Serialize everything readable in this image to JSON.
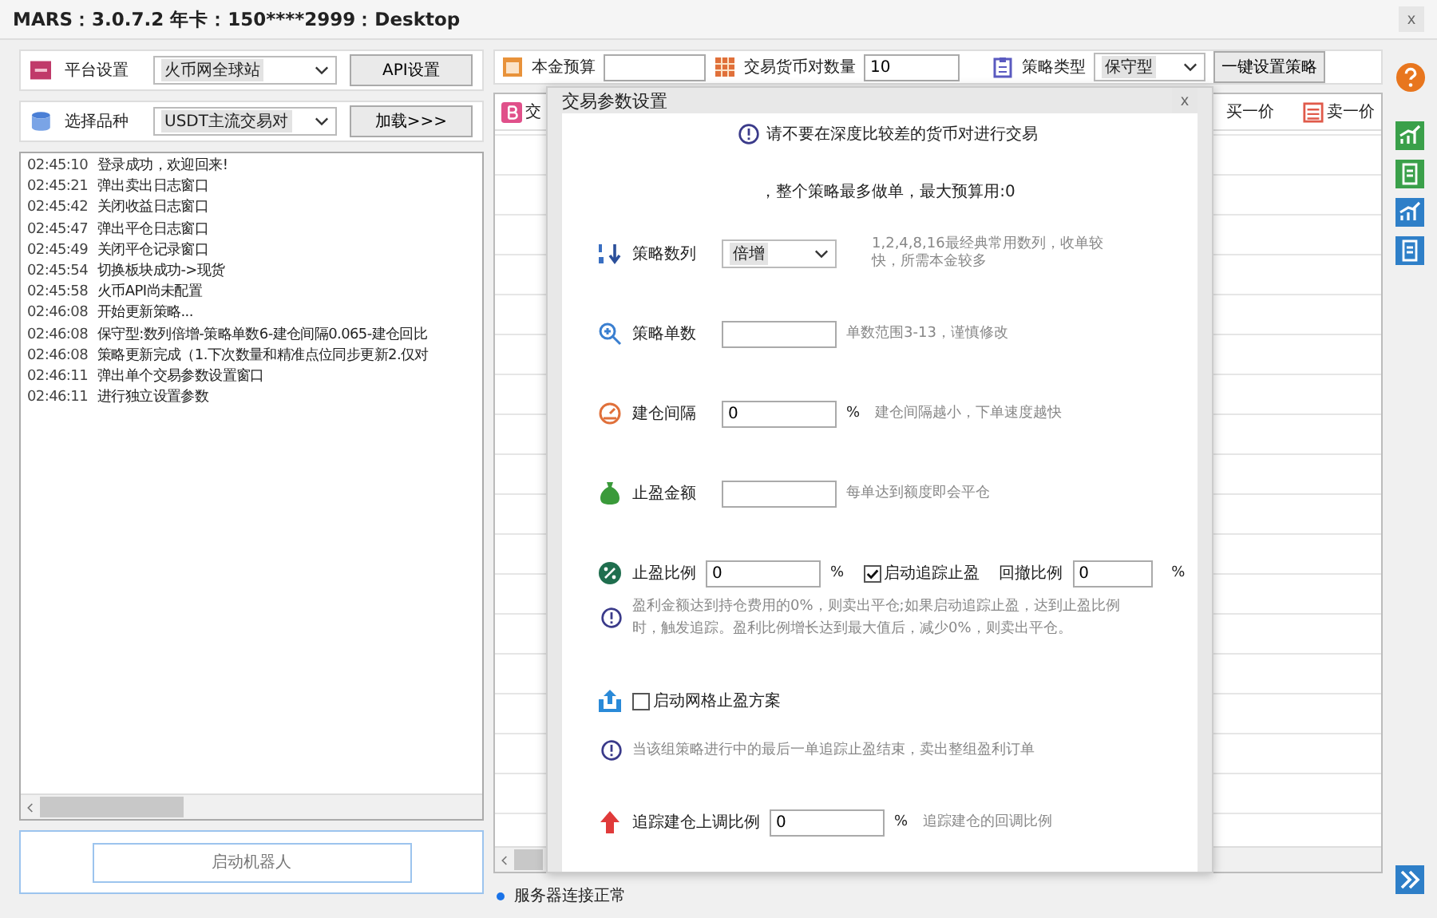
{
  "window": {
    "title": "MARS：3.0.7.2  年卡：150****2999：Desktop",
    "close": "x"
  },
  "platform": {
    "label": "平台设置",
    "value": "火币网全球站",
    "button": "API设置"
  },
  "symbol": {
    "label": "选择品种",
    "value": "USDT主流交易对",
    "button": "加载>>>"
  },
  "log": [
    {
      "time": "02:45:10",
      "text": "登录成功，欢迎回来!"
    },
    {
      "time": "02:45:21",
      "text": "弹出卖出日志窗口"
    },
    {
      "time": "02:45:42",
      "text": "关闭收益日志窗口"
    },
    {
      "time": "02:45:47",
      "text": "弹出平仓日志窗口"
    },
    {
      "time": "02:45:49",
      "text": "关闭平仓记录窗口"
    },
    {
      "time": "02:45:54",
      "text": "切换板块成功->现货"
    },
    {
      "time": "02:45:58",
      "text": "火币API尚未配置"
    },
    {
      "time": "02:46:08",
      "text": "开始更新策略..."
    },
    {
      "time": "02:46:08",
      "text": "保守型:数列倍增-策略单数6-建仓间隔0.065-建仓回比"
    },
    {
      "time": "02:46:08",
      "text": "策略更新完成（1.下次数量和精准点位同步更新2.仅对"
    },
    {
      "time": "02:46:11",
      "text": "弹出单个交易参数设置窗口"
    },
    {
      "time": "02:46:11",
      "text": "进行独立设置参数"
    }
  ],
  "start_button": "启动机器人",
  "toolbar": {
    "budget_label": "本金预算",
    "pairs_label": "交易货币对数量",
    "pairs_value": "10",
    "type_label": "策略类型",
    "type_value": "保守型",
    "button": "一键设置策略"
  },
  "table": {
    "columns": [
      "交",
      "买一价",
      "卖一价"
    ]
  },
  "status_bar": "服务器连接正常",
  "dialog": {
    "title": "交易参数设置",
    "close": "x",
    "warning": "请不要在深度比较差的货币对进行交易",
    "summary": "，整个策略最多做单，最大预算用:0",
    "rows": [
      {
        "kind": "select",
        "label": "策略数列",
        "value": "倍增",
        "hint": "1,2,4,8,16最经典常用数列，收单较快，所需本金较多"
      },
      {
        "kind": "input",
        "label": "策略单数",
        "hint": "单数范围3-13，谨慎修改"
      },
      {
        "kind": "input",
        "label": "建仓间隔",
        "value": "0",
        "unit": "%",
        "hint": "建仓间隔越小，下单速度越快"
      },
      {
        "kind": "input",
        "label": "止盈金额",
        "hint": "每单达到额度即会平仓"
      },
      {
        "kind": "ratio",
        "label": "止盈比例",
        "value": "0",
        "unit": "%",
        "check_label": "启动追踪止盈",
        "checked": true,
        "pullback_label": "回撤比例",
        "pullback_value": "0",
        "pullback_unit": "%",
        "note": "盈利金额达到持仓费用的0%，则卖出平仓;如果启动追踪止盈，达到止盈比例时，触发追踪。盈利比例增长达到最大值后，减少0%，则卖出平仓。"
      },
      {
        "kind": "checkbox",
        "label": "启动网格止盈方案",
        "checked": false,
        "note": "当该组策略进行中的最后一单追踪止盈结束，卖出整组盈利订单"
      },
      {
        "kind": "input",
        "label": "追踪建仓上调比例",
        "value": "0",
        "unit": "%",
        "hint": "追踪建仓的回调比例"
      }
    ]
  }
}
